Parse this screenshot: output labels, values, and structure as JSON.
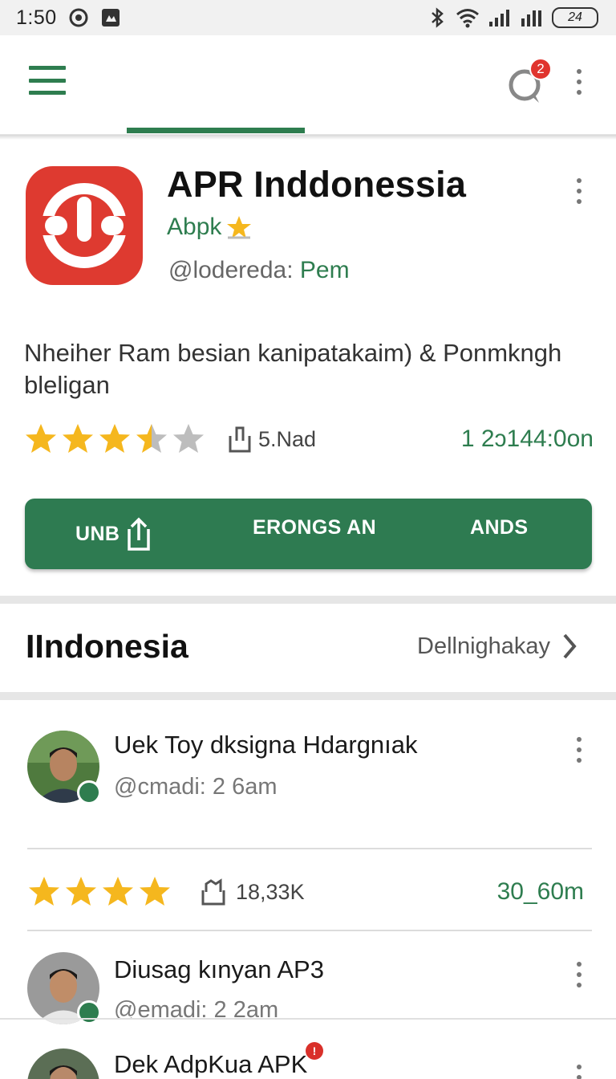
{
  "status_bar": {
    "time": "1:50",
    "battery": "24"
  },
  "top_bar": {
    "notification_count": "2"
  },
  "app": {
    "title": "APR Inddonessia",
    "developer": "Abpk",
    "meta_prefix": "@lodereda: ",
    "meta_suffix": "Pem",
    "description": "Nheiher Ram besian kanipatakaim) & Ponmkngh bleligan",
    "rating": 3.5,
    "downloads": "5.Nad",
    "installs": "1 2ɔ144:0on",
    "actions": {
      "first": "UNB",
      "second": "ERONGS AN",
      "third": "ANDS"
    }
  },
  "section": {
    "title": "IIndonesia",
    "link": "Dellnighakay"
  },
  "list": {
    "items": [
      {
        "title": "Uek Toy dksigna Hdargnıak",
        "subtitle": "@cmadi: 2 6am"
      },
      {
        "title": "Diusag kınyan AP3",
        "subtitle": "@emadi: 2 2am"
      },
      {
        "title": "Dek AdpKua APK",
        "subtitle": ""
      }
    ],
    "stats": {
      "rating": 4,
      "downloads": "18,33K",
      "size": "30_60m"
    }
  },
  "colors": {
    "primary_green": "#2e7d4f",
    "app_red": "#de3a30",
    "star_gold": "#f5b71e",
    "star_gray": "#bdbdbd",
    "badge_red": "#e0342e"
  },
  "icons": [
    "menu-icon",
    "chat-icon",
    "more-vert-icon",
    "star-icon",
    "download-icon",
    "upload-icon",
    "chevron-right-icon",
    "bluetooth-icon",
    "wifi-icon",
    "signal-icon"
  ]
}
